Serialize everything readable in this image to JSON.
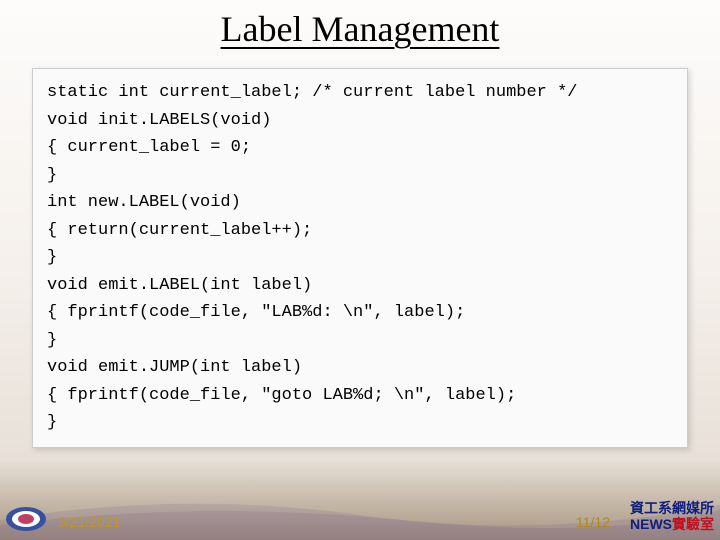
{
  "title": "Label Management",
  "code": {
    "l1": "static int current_label; /* current label number */",
    "l2": "void init.LABELS(void)",
    "l3": "{ current_label = 0;",
    "l4": "}",
    "l5": "int new.LABEL(void)",
    "l6": "{ return(current_label++);",
    "l7": "}",
    "l8": "void emit.LABEL(int label)",
    "l9": "{ fprintf(code_file, \"LAB%d: \\n\", label);",
    "l10": "}",
    "l11": "void emit.JUMP(int label)",
    "l12": "{ fprintf(code_file, \"goto LAB%d; \\n\", label);",
    "l13": "}"
  },
  "footer": {
    "date": "5/21/2021",
    "page": "11/12",
    "lab_line1": "資工系網媒所",
    "lab_line2_a": "NEWS",
    "lab_line2_b": "實驗室"
  }
}
